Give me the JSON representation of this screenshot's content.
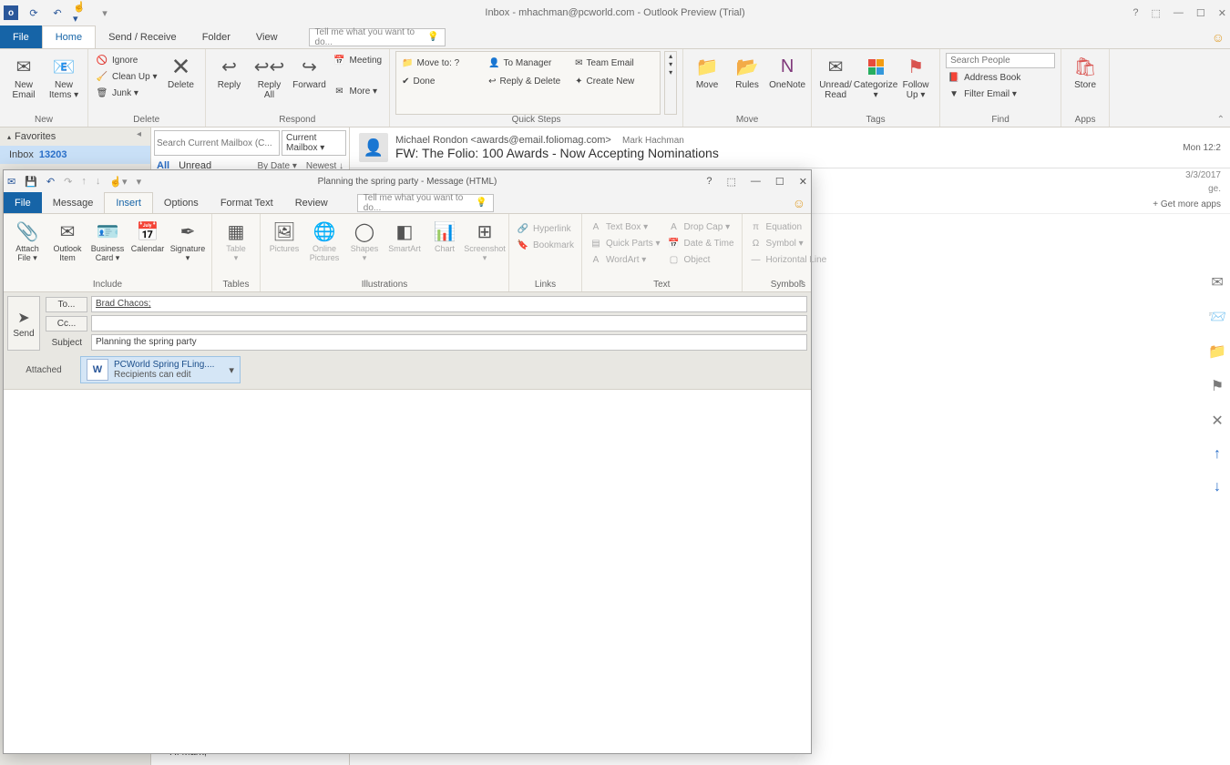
{
  "app": {
    "title": "Inbox - mhachman@pcworld.com - Outlook Preview (Trial)"
  },
  "main_tabs": {
    "file": "File",
    "home": "Home",
    "send_receive": "Send / Receive",
    "folder": "Folder",
    "view": "View"
  },
  "tellme_placeholder": "Tell me what you want to do...",
  "ribbon": {
    "new": {
      "label": "New",
      "new_email": "New\nEmail",
      "new_items": "New\nItems ▾"
    },
    "delete": {
      "label": "Delete",
      "ignore": "Ignore",
      "clean_up": "Clean Up ▾",
      "junk": "Junk ▾",
      "delete": "Delete"
    },
    "respond": {
      "label": "Respond",
      "reply": "Reply",
      "reply_all": "Reply\nAll",
      "forward": "Forward",
      "meeting": "Meeting",
      "more": "More ▾"
    },
    "quick_steps": {
      "label": "Quick Steps",
      "move_to": "Move to: ?",
      "to_manager": "To Manager",
      "team_email": "Team Email",
      "done": "Done",
      "reply_delete": "Reply & Delete",
      "create_new": "Create New"
    },
    "move": {
      "label": "Move",
      "move": "Move",
      "rules": "Rules",
      "onenote": "OneNote"
    },
    "tags": {
      "label": "Tags",
      "unread": "Unread/\nRead",
      "categorize": "Categorize\n▾",
      "follow_up": "Follow\nUp ▾"
    },
    "find": {
      "label": "Find",
      "search_people": "Search People",
      "address_book": "Address Book",
      "filter_email": "Filter Email ▾"
    },
    "apps": {
      "label": "Apps",
      "store": "Store"
    }
  },
  "nav": {
    "favorites": "Favorites",
    "inbox": "Inbox",
    "inbox_count": "13203"
  },
  "list": {
    "search_placeholder": "Search Current Mailbox (C...",
    "scope": "Current Mailbox",
    "all": "All",
    "unread": "Unread",
    "by_date": "By Date ▾",
    "newest": "Newest ↓"
  },
  "reading": {
    "from": "Michael Rondon <awards@email.foliomag.com>",
    "mark": "Mark Hachman",
    "time": "Mon 12:2",
    "subject": "FW: The Folio: 100 Awards - Now Accepting Nominations",
    "date2": "3/3/2017",
    "get_apps": "+  Get more apps",
    "greeting": "Hi Mark,"
  },
  "compose": {
    "title": "Planning the spring party - Message (HTML)",
    "tabs": {
      "file": "File",
      "message": "Message",
      "insert": "Insert",
      "options": "Options",
      "format_text": "Format Text",
      "review": "Review"
    },
    "ribbon": {
      "include": {
        "label": "Include",
        "attach_file": "Attach\nFile ▾",
        "outlook_item": "Outlook\nItem",
        "business_card": "Business\nCard ▾",
        "calendar": "Calendar",
        "signature": "Signature\n▾"
      },
      "tables": {
        "label": "Tables",
        "table": "Table\n▾"
      },
      "illustrations": {
        "label": "Illustrations",
        "pictures": "Pictures",
        "online_pictures": "Online\nPictures",
        "shapes": "Shapes\n▾",
        "smartart": "SmartArt",
        "chart": "Chart",
        "screenshot": "Screenshot\n▾"
      },
      "links": {
        "label": "Links",
        "hyperlink": "Hyperlink",
        "bookmark": "Bookmark"
      },
      "text": {
        "label": "Text",
        "text_box": "Text Box ▾",
        "quick_parts": "Quick Parts ▾",
        "wordart": "WordArt ▾",
        "drop_cap": "Drop Cap ▾",
        "date_time": "Date & Time",
        "object": "Object"
      },
      "symbols": {
        "label": "Symbols",
        "equation": "Equation",
        "symbol": "Symbol ▾",
        "horizontal_line": "Horizontal Line"
      }
    },
    "fields": {
      "send": "Send",
      "to_label": "To...",
      "to_value": "Brad Chacos;",
      "cc_label": "Cc...",
      "subject_label": "Subject",
      "subject_value": "Planning the spring party",
      "attached_label": "Attached"
    },
    "attachment": {
      "name": "PCWorld Spring FLing....",
      "sub": "Recipients can edit"
    }
  }
}
